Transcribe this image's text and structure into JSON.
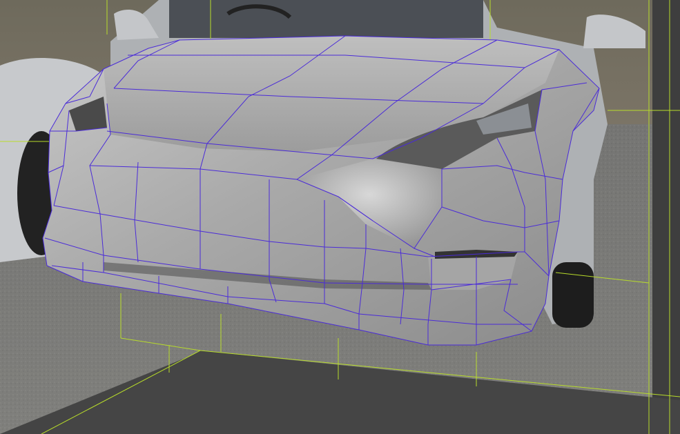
{
  "viewport": {
    "view": "perspective",
    "display_mode": "shaded-with-wireframe"
  },
  "colors": {
    "wireframe": "#4a2bd8",
    "grid": "#b8dc2a",
    "model_shade": "#a7a7a7",
    "floor": "#454545",
    "backdrop_sky": "#6f6650"
  },
  "objects": [
    {
      "name": "reference-image-plane",
      "icon": "image-plane"
    },
    {
      "name": "car-front-model",
      "icon": "polygon-mesh"
    },
    {
      "name": "ground-grid",
      "icon": "grid"
    }
  ]
}
